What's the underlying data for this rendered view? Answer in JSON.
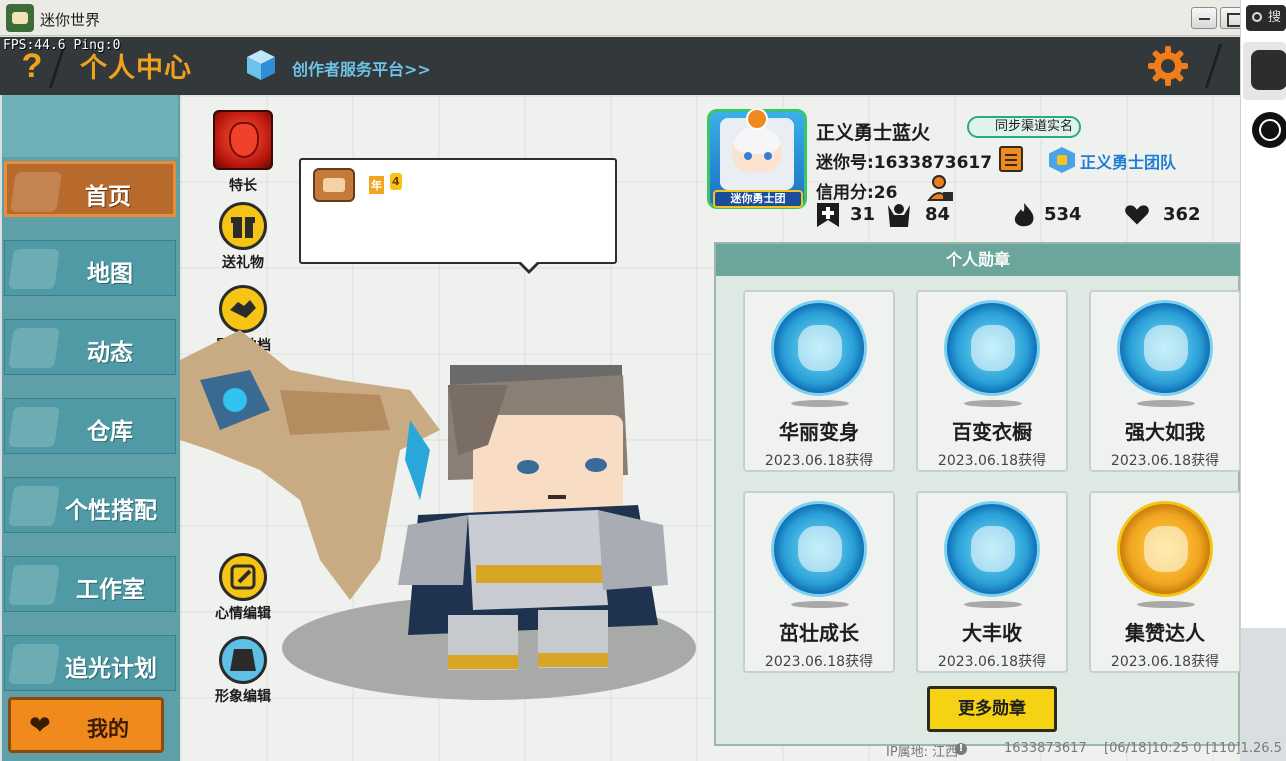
{
  "window": {
    "title": "迷你世界"
  },
  "fps_readout": "FPS:44.6  Ping:0",
  "header": {
    "title": "个人中心",
    "platform_link": "创作者服务平台>>"
  },
  "nav": {
    "items": [
      {
        "label": "首页",
        "active": true
      },
      {
        "label": "地图",
        "active": false
      },
      {
        "label": "动态",
        "active": false
      },
      {
        "label": "仓库",
        "active": false
      },
      {
        "label": "个性搭配",
        "active": false
      },
      {
        "label": "工作室",
        "active": false
      },
      {
        "label": "追光计划",
        "active": false
      }
    ],
    "mine_label": "我的"
  },
  "side_actions": {
    "talent": "特长",
    "gift": "送礼物",
    "partner": "最佳拍档",
    "mood": "心情编辑",
    "appearance": "形象编辑"
  },
  "bubble": {
    "badge_year": "年",
    "badge_extra": "4"
  },
  "profile": {
    "avatar_plaque": "迷你勇士团",
    "nickname": "正义勇士蓝火",
    "realname_badge": "同步渠道实名",
    "mini_id": "迷你号:1633873617",
    "team": "正义勇士团队",
    "credit": "信用分:26",
    "stats": {
      "follow": "31",
      "fans": "84",
      "heat": "534",
      "likes": "362"
    }
  },
  "medals": {
    "header": "个人勋章",
    "items": [
      {
        "name": "华丽变身",
        "date": "2023.06.18获得",
        "tier": "blue"
      },
      {
        "name": "百变衣橱",
        "date": "2023.06.18获得",
        "tier": "blue"
      },
      {
        "name": "强大如我",
        "date": "2023.06.18获得",
        "tier": "blue"
      },
      {
        "name": "茁壮成长",
        "date": "2023.06.18获得",
        "tier": "blue"
      },
      {
        "name": "大丰收",
        "date": "2023.06.18获得",
        "tier": "blue"
      },
      {
        "name": "集赞达人",
        "date": "2023.06.18获得",
        "tier": "gold"
      }
    ],
    "more_button": "更多勋章"
  },
  "footer": {
    "ip": "IP属地: 江西",
    "uid": "1633873617",
    "timestamp": "[06/18]10:25 0  [110]1.26.5"
  },
  "overlay": {
    "search_placeholder": "搜"
  },
  "colors": {
    "accent": "#f0a21b",
    "nav": "#4f9aa4",
    "active_nav": "#b86a2d",
    "medal_header": "#6ba59b"
  }
}
